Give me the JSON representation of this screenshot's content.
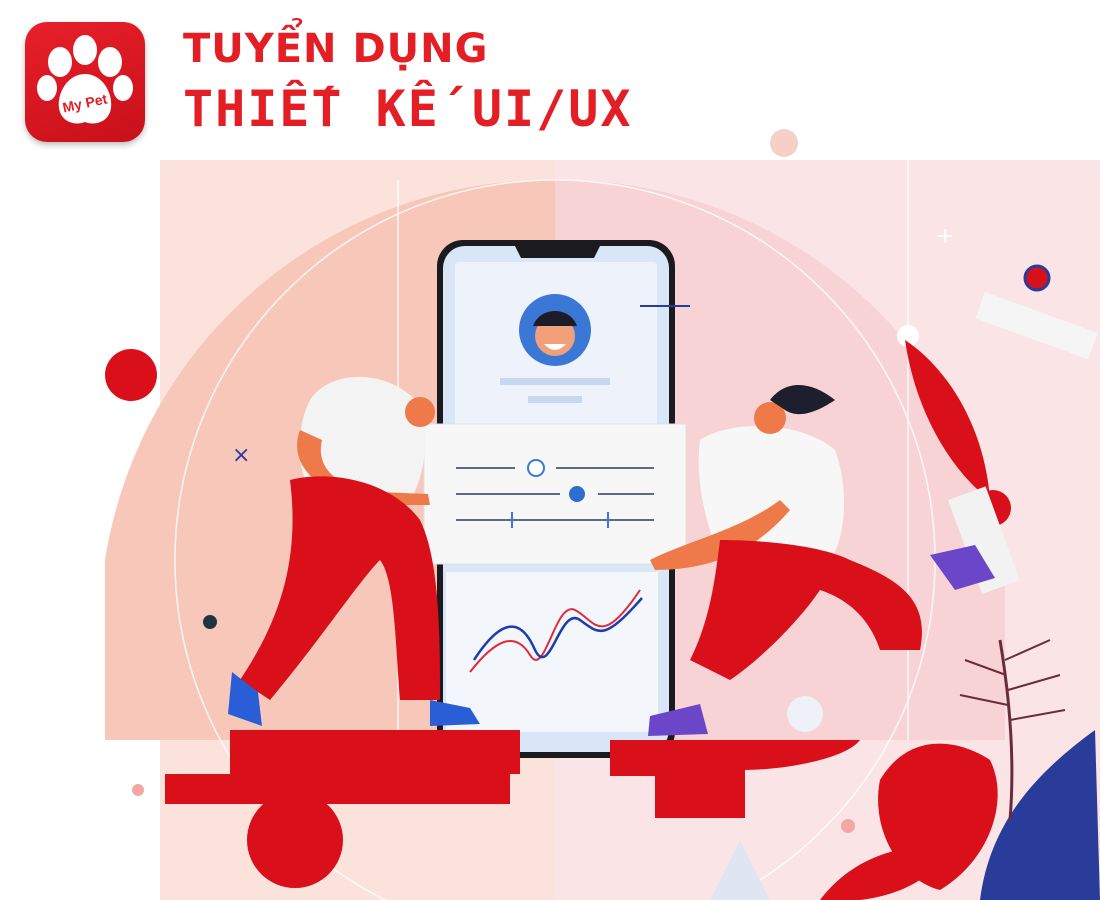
{
  "brand": {
    "logo_text": "My Pet",
    "accent_color": "#e31e24"
  },
  "header": {
    "line1": "TUYỂN DỤNG",
    "line2": "THIẾT KẾ UI/UX"
  },
  "illustration": {
    "description_icons": [
      "paw-icon",
      "avatar-icon",
      "slider-icon",
      "line-chart-icon"
    ]
  }
}
